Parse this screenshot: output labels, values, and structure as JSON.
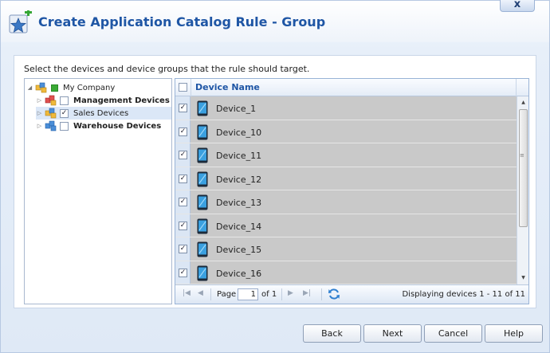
{
  "dialog": {
    "title": "Create Application Catalog Rule - Group",
    "close_label": "x"
  },
  "instructions": "Select the devices and device groups that the rule should target.",
  "tree": {
    "root": {
      "label": "My Company",
      "expanded": true
    },
    "children": [
      {
        "label": "Management Devices",
        "checked": false,
        "selected": false
      },
      {
        "label": "Sales Devices",
        "checked": true,
        "selected": true
      },
      {
        "label": "Warehouse Devices",
        "checked": false,
        "selected": false
      }
    ]
  },
  "grid": {
    "column_header": "Device Name",
    "rows": [
      {
        "name": "Device_1",
        "checked": true
      },
      {
        "name": "Device_10",
        "checked": true
      },
      {
        "name": "Device_11",
        "checked": true
      },
      {
        "name": "Device_12",
        "checked": true
      },
      {
        "name": "Device_13",
        "checked": true
      },
      {
        "name": "Device_14",
        "checked": true
      },
      {
        "name": "Device_15",
        "checked": true
      },
      {
        "name": "Device_16",
        "checked": true
      }
    ]
  },
  "pager": {
    "page_label": "Page",
    "page_value": "1",
    "of_label": "of 1",
    "status": "Displaying devices 1 - 11 of 11"
  },
  "buttons": {
    "back": "Back",
    "next": "Next",
    "cancel": "Cancel",
    "help": "Help"
  },
  "colors": {
    "title": "#1f56a5",
    "row_bg": "#c9c9c9",
    "accent": "#1f56a5"
  }
}
